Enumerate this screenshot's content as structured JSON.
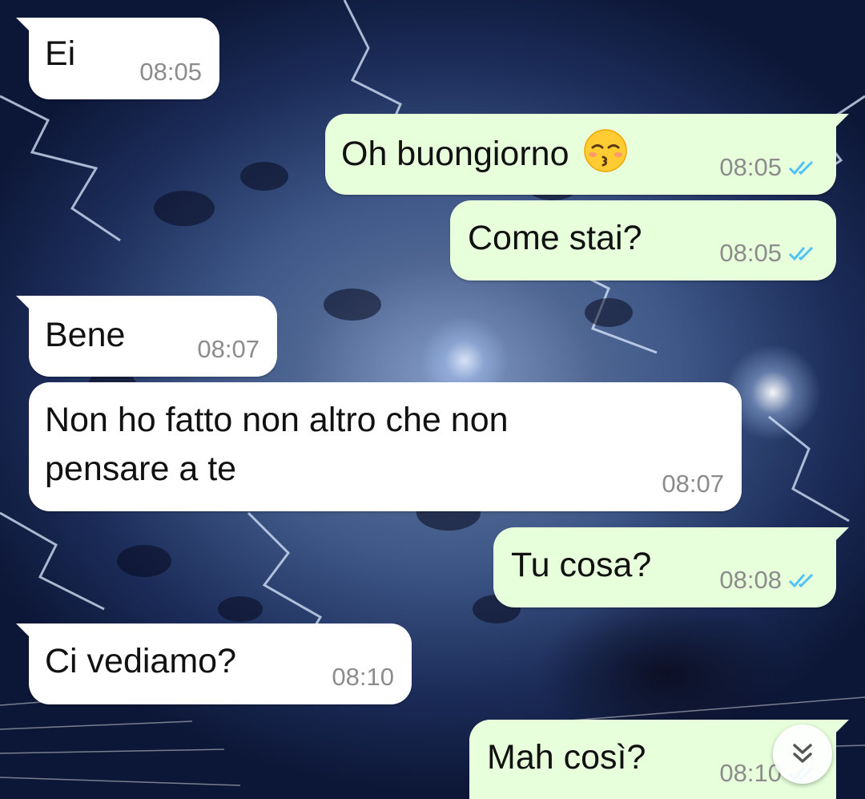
{
  "colors": {
    "incoming_bubble": "#ffffff",
    "outgoing_bubble": "#e7ffdb",
    "time_text": "#8c8c8c",
    "read_ticks": "#4fc3f7"
  },
  "messages": [
    {
      "direction": "incoming",
      "text": "Ei",
      "time": "08:05"
    },
    {
      "direction": "outgoing",
      "text": "Oh buongiorno",
      "emoji": "kissing-face-closed-eyes",
      "time": "08:05",
      "status": "read"
    },
    {
      "direction": "outgoing",
      "text": "Come stai?",
      "time": "08:05",
      "status": "read"
    },
    {
      "direction": "incoming",
      "text": "Bene",
      "time": "08:07"
    },
    {
      "direction": "incoming",
      "lines": [
        "Non ho fatto non altro che non",
        "pensare a te"
      ],
      "time": "08:07"
    },
    {
      "direction": "outgoing",
      "text": "Tu cosa?",
      "time": "08:08",
      "status": "read"
    },
    {
      "direction": "incoming",
      "text": "Ci vediamo?",
      "time": "08:10"
    },
    {
      "direction": "outgoing",
      "text": "Mah così?",
      "time": "08:10",
      "status": "read"
    }
  ],
  "scroll_button": {
    "icon": "double-chevron-down-icon"
  }
}
